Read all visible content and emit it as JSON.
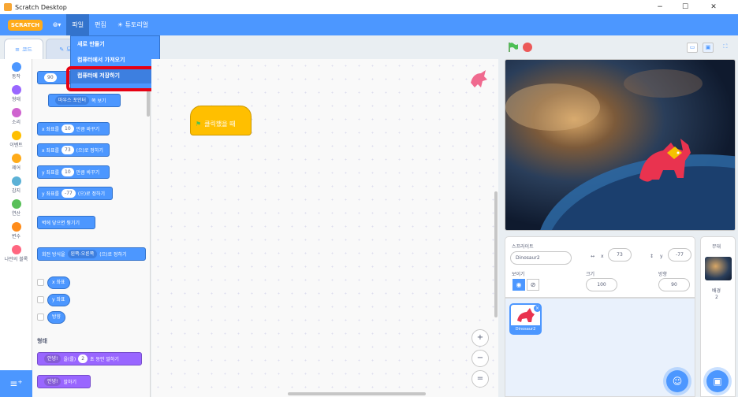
{
  "window": {
    "title": "Scratch Desktop",
    "minimize": "−",
    "maximize": "☐",
    "close": "✕"
  },
  "menubar": {
    "logo": "SCRATCH",
    "language_icon": "globe-icon",
    "file": "파일",
    "edit": "편집",
    "tutorials": "튜토리얼"
  },
  "file_menu": {
    "items": [
      "새로 만들기",
      "컴퓨터에서 가져오기",
      "컴퓨터에 저장하기"
    ],
    "highlighted": "컴퓨터에 저장하기"
  },
  "tabs": {
    "code": "코드",
    "costumes": "모"
  },
  "categories": [
    {
      "label": "동작",
      "color": "#4c97ff"
    },
    {
      "label": "형태",
      "color": "#9966ff"
    },
    {
      "label": "소리",
      "color": "#cf63cf"
    },
    {
      "label": "이벤트",
      "color": "#ffbf00"
    },
    {
      "label": "제어",
      "color": "#ffab19"
    },
    {
      "label": "감지",
      "color": "#5cb1d6"
    },
    {
      "label": "연산",
      "color": "#59c059"
    },
    {
      "label": "변수",
      "color": "#ff8c1a"
    },
    {
      "label": "나만의 블록",
      "color": "#ff6680"
    }
  ],
  "blocks": {
    "point_value": "90",
    "towards": "마우스 포인터",
    "towards_suffix": "쪽 보기",
    "change_x_pre": "x 좌표를",
    "change_x_val": "10",
    "change_x_suf": "만큼 바꾸기",
    "set_x_pre": "x 좌표를",
    "set_x_val": "73",
    "set_x_suf": "(으)로 정하기",
    "change_y_pre": "y 좌표를",
    "change_y_val": "10",
    "change_y_suf": "만큼 바꾸기",
    "set_y_pre": "y 좌표를",
    "set_y_val": "-77",
    "set_y_suf": "(으)로 정하기",
    "bounce": "벽에 닿으면 튕기기",
    "rot_pre": "회전 방식을",
    "rot_val": "왼쪽-오른쪽",
    "rot_suf": "(으)로 정하기",
    "rep_x": "x 좌표",
    "rep_y": "y 좌표",
    "rep_dir": "방향",
    "looks_title": "형태",
    "say_for_val": "안녕!",
    "say_for_mid": "을(를)",
    "say_for_secs": "2",
    "say_for_suf": "초 동안 말하기",
    "say_val": "안녕!",
    "say_suf": "말하기"
  },
  "script": {
    "when_flag": "클릭했을 때"
  },
  "zoom": {
    "in": "+",
    "out": "−",
    "reset": "="
  },
  "sprite_info": {
    "sprite_label": "스프라이트",
    "sprite_name": "Dinosaur2",
    "x_label": "x",
    "x_value": "73",
    "y_label": "y",
    "y_value": "-77",
    "show_label": "보이기",
    "size_label": "크기",
    "size_value": "100",
    "direction_label": "방향",
    "direction_value": "90"
  },
  "sprite_list": [
    {
      "name": "Dinosaur2",
      "selected": true
    }
  ],
  "stage_panel": {
    "label": "무대",
    "backdrops_label": "배경",
    "backdrops_count": "2"
  }
}
